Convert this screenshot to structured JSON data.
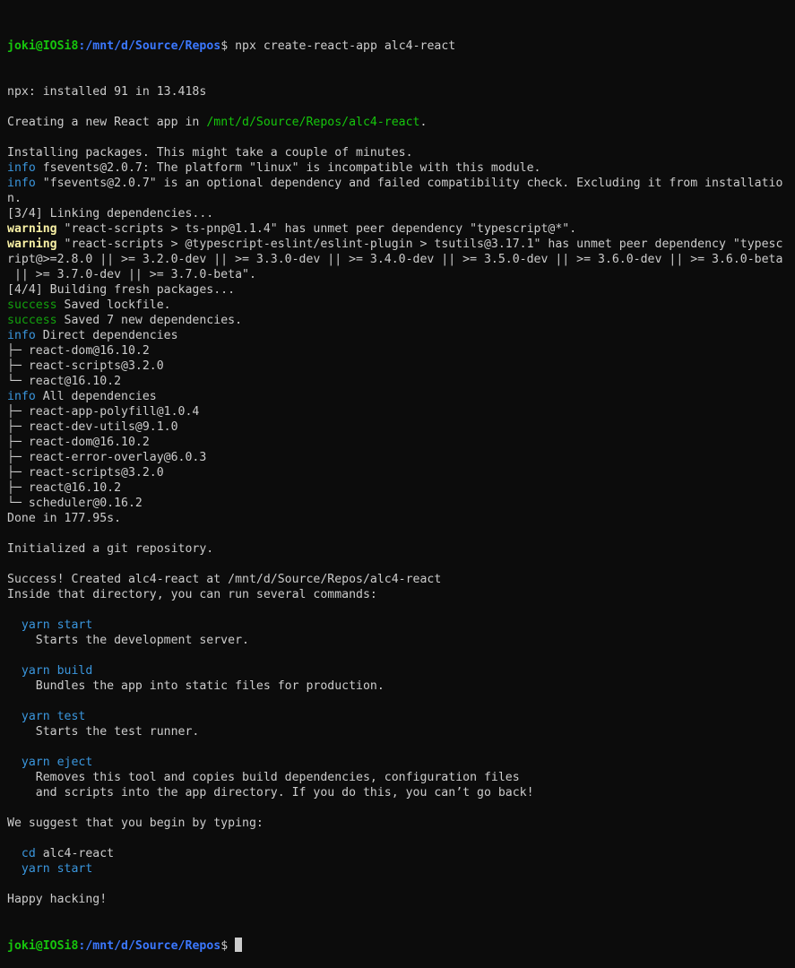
{
  "prompt": {
    "user_host": "joki@IOSi8",
    "path": ":/mnt/d/Source/Repos",
    "symbol": "$",
    "command": " npx create-react-app alc4-react"
  },
  "lines": [
    {
      "segs": [
        {
          "t": "npx: installed 91 in 13.418s"
        }
      ]
    },
    {
      "segs": []
    },
    {
      "segs": [
        {
          "t": "Creating a new React app in "
        },
        {
          "t": "/mnt/d/Source/Repos/alc4-react",
          "c": "green"
        },
        {
          "t": "."
        }
      ]
    },
    {
      "segs": []
    },
    {
      "segs": [
        {
          "t": "Installing packages. This might take a couple of minutes."
        }
      ]
    },
    {
      "segs": [
        {
          "t": "info",
          "c": "cyan"
        },
        {
          "t": " fsevents@2.0.7: The platform \"linux\" is incompatible with this module."
        }
      ]
    },
    {
      "segs": [
        {
          "t": "info",
          "c": "cyan"
        },
        {
          "t": " \"fsevents@2.0.7\" is an optional dependency and failed compatibility check. Excluding it from installatio"
        }
      ]
    },
    {
      "segs": [
        {
          "t": "n."
        }
      ]
    },
    {
      "segs": [
        {
          "t": "[3/4] Linking dependencies..."
        }
      ]
    },
    {
      "segs": [
        {
          "t": "warning",
          "c": "yellow"
        },
        {
          "t": " \"react-scripts > ts-pnp@1.1.4\" has unmet peer dependency \"typescript@*\"."
        }
      ]
    },
    {
      "segs": [
        {
          "t": "warning",
          "c": "yellow"
        },
        {
          "t": " \"react-scripts > @typescript-eslint/eslint-plugin > tsutils@3.17.1\" has unmet peer dependency \"typesc"
        }
      ]
    },
    {
      "segs": [
        {
          "t": "ript@>=2.8.0 || >= 3.2.0-dev || >= 3.3.0-dev || >= 3.4.0-dev || >= 3.5.0-dev || >= 3.6.0-dev || >= 3.6.0-beta"
        }
      ]
    },
    {
      "segs": [
        {
          "t": " || >= 3.7.0-dev || >= 3.7.0-beta\"."
        }
      ]
    },
    {
      "segs": [
        {
          "t": "[4/4] Building fresh packages..."
        }
      ]
    },
    {
      "segs": [
        {
          "t": "success",
          "c": "bgreen"
        },
        {
          "t": " Saved lockfile."
        }
      ]
    },
    {
      "segs": [
        {
          "t": "success",
          "c": "bgreen"
        },
        {
          "t": " Saved 7 new dependencies."
        }
      ]
    },
    {
      "segs": [
        {
          "t": "info",
          "c": "cyan"
        },
        {
          "t": " Direct dependencies"
        }
      ]
    },
    {
      "segs": [
        {
          "t": "├─ react-dom@16.10.2"
        }
      ]
    },
    {
      "segs": [
        {
          "t": "├─ react-scripts@3.2.0"
        }
      ]
    },
    {
      "segs": [
        {
          "t": "└─ react@16.10.2"
        }
      ]
    },
    {
      "segs": [
        {
          "t": "info",
          "c": "cyan"
        },
        {
          "t": " All dependencies"
        }
      ]
    },
    {
      "segs": [
        {
          "t": "├─ react-app-polyfill@1.0.4"
        }
      ]
    },
    {
      "segs": [
        {
          "t": "├─ react-dev-utils@9.1.0"
        }
      ]
    },
    {
      "segs": [
        {
          "t": "├─ react-dom@16.10.2"
        }
      ]
    },
    {
      "segs": [
        {
          "t": "├─ react-error-overlay@6.0.3"
        }
      ]
    },
    {
      "segs": [
        {
          "t": "├─ react-scripts@3.2.0"
        }
      ]
    },
    {
      "segs": [
        {
          "t": "├─ react@16.10.2"
        }
      ]
    },
    {
      "segs": [
        {
          "t": "└─ scheduler@0.16.2"
        }
      ]
    },
    {
      "segs": [
        {
          "t": "Done in 177.95s."
        }
      ]
    },
    {
      "segs": []
    },
    {
      "segs": [
        {
          "t": "Initialized a git repository."
        }
      ]
    },
    {
      "segs": []
    },
    {
      "segs": [
        {
          "t": "Success! Created alc4-react at /mnt/d/Source/Repos/alc4-react"
        }
      ]
    },
    {
      "segs": [
        {
          "t": "Inside that directory, you can run several commands:"
        }
      ]
    },
    {
      "segs": []
    },
    {
      "segs": [
        {
          "t": "  "
        },
        {
          "t": "yarn start",
          "c": "cyan"
        }
      ]
    },
    {
      "segs": [
        {
          "t": "    Starts the development server."
        }
      ]
    },
    {
      "segs": []
    },
    {
      "segs": [
        {
          "t": "  "
        },
        {
          "t": "yarn build",
          "c": "cyan"
        }
      ]
    },
    {
      "segs": [
        {
          "t": "    Bundles the app into static files for production."
        }
      ]
    },
    {
      "segs": []
    },
    {
      "segs": [
        {
          "t": "  "
        },
        {
          "t": "yarn test",
          "c": "cyan"
        }
      ]
    },
    {
      "segs": [
        {
          "t": "    Starts the test runner."
        }
      ]
    },
    {
      "segs": []
    },
    {
      "segs": [
        {
          "t": "  "
        },
        {
          "t": "yarn eject",
          "c": "cyan"
        }
      ]
    },
    {
      "segs": [
        {
          "t": "    Removes this tool and copies build dependencies, configuration files"
        }
      ]
    },
    {
      "segs": [
        {
          "t": "    and scripts into the app directory. If you do this, you can’t go back!"
        }
      ]
    },
    {
      "segs": []
    },
    {
      "segs": [
        {
          "t": "We suggest that you begin by typing:"
        }
      ]
    },
    {
      "segs": []
    },
    {
      "segs": [
        {
          "t": "  "
        },
        {
          "t": "cd",
          "c": "cyan"
        },
        {
          "t": " alc4-react"
        }
      ]
    },
    {
      "segs": [
        {
          "t": "  "
        },
        {
          "t": "yarn start",
          "c": "cyan"
        }
      ]
    },
    {
      "segs": []
    },
    {
      "segs": [
        {
          "t": "Happy hacking!"
        }
      ]
    }
  ],
  "final_prompt": {
    "user_host": "joki@IOSi8",
    "path": ":/mnt/d/Source/Repos",
    "symbol": "$ "
  },
  "colors": {
    "background": "#0c0c0c",
    "foreground": "#cccccc",
    "green": "#16c60c",
    "blue": "#3b78ff",
    "cyan": "#3a96dd",
    "yellow": "#f9f1a5"
  }
}
